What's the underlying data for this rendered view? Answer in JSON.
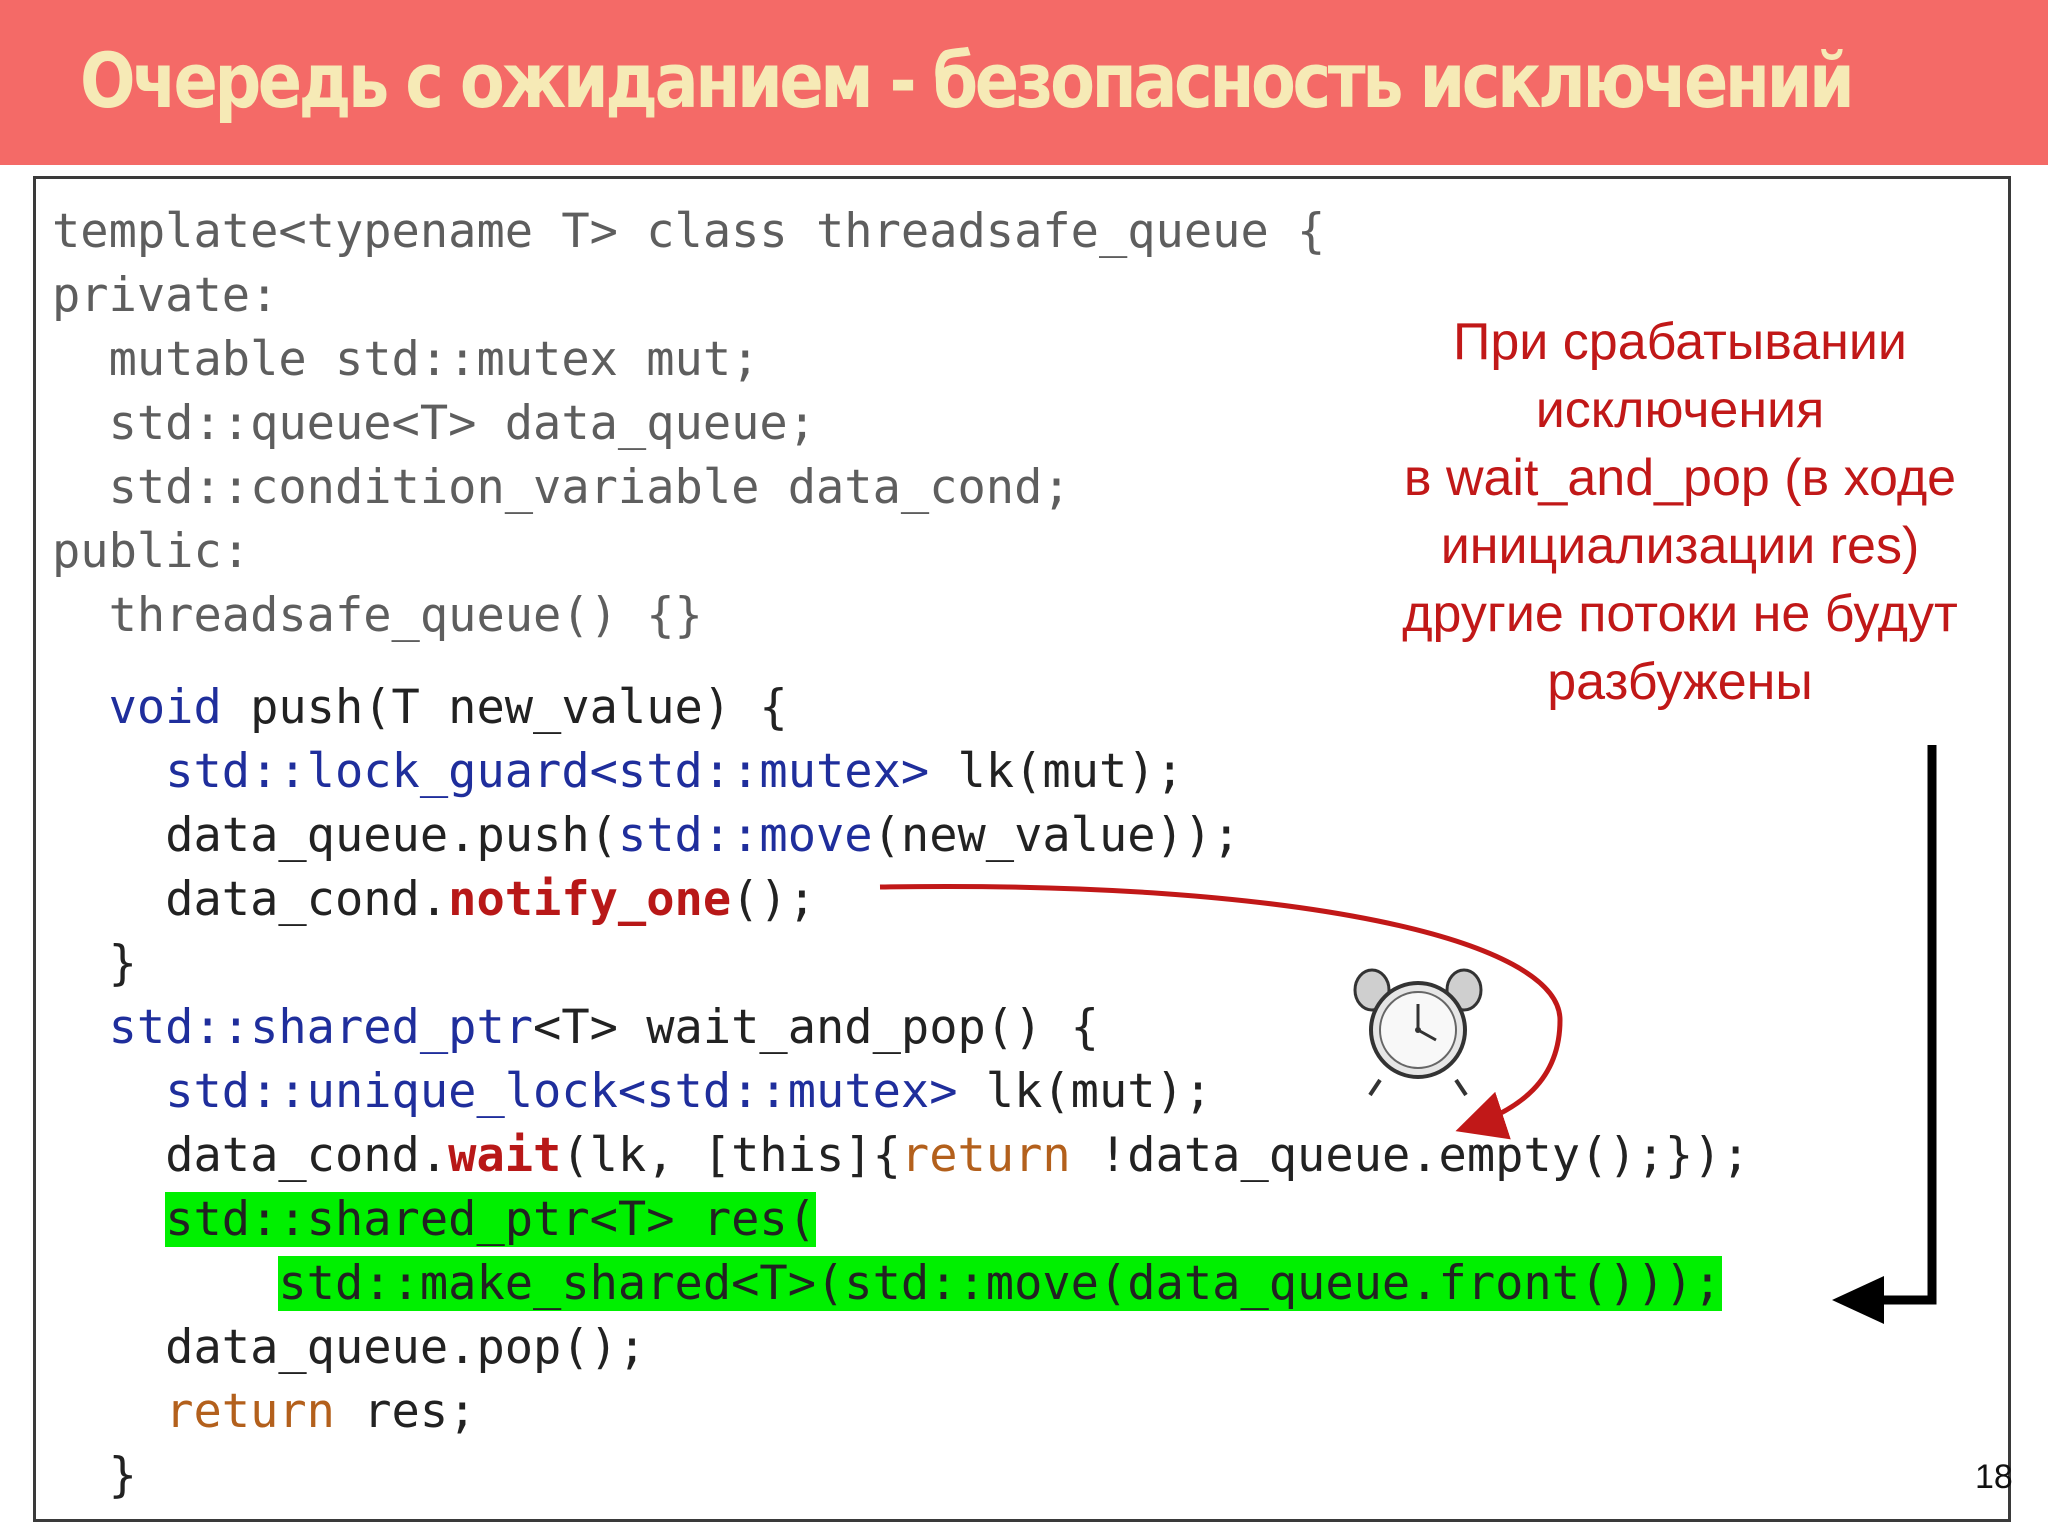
{
  "slide": {
    "title": "Очередь с ожиданием - безопасность исключений",
    "page_number": "18",
    "colors": {
      "title_bar": "#f46a67",
      "title_text": "#f6eab6",
      "keyword": "#1f2e9c",
      "return_keyword": "#b3601c",
      "notify_wait": "#b81818",
      "highlight": "#00f000",
      "note_text": "#c11818"
    }
  },
  "code": {
    "line1": "template<typename T> class threadsafe_queue {",
    "line2": "private:",
    "line3": "  mutable std::mutex mut;",
    "line4": "  std::queue<T> data_queue;",
    "line5": "  std::condition_variable data_cond;",
    "line6": "public:",
    "line7": "  threadsafe_queue() {}",
    "line8": {
      "indent": "  ",
      "kw": "void",
      "rest": " push(T new_value) {"
    },
    "line9": {
      "indent": "    ",
      "kw": "std::lock_guard<std::mutex>",
      "rest": " lk(mut);"
    },
    "line10": {
      "indent": "    ",
      "a": "data_queue.push(",
      "kw": "std::move",
      "rest": "(new_value));"
    },
    "line11": {
      "indent": "    ",
      "a": "data_cond.",
      "red": "notify_one",
      "rest": "();"
    },
    "line12": "  }",
    "line13": {
      "indent": "  ",
      "kw": "std::shared_ptr",
      "rest": "<T> wait_and_pop() {"
    },
    "line14": {
      "indent": "    ",
      "kw": "std::unique_lock<std::mutex>",
      "rest": " lk(mut);"
    },
    "line15": {
      "indent": "    ",
      "a": "data_cond.",
      "red": "wait",
      "b": "(lk, [this]{",
      "ret": "return",
      "rest": " !data_queue.empty();});"
    },
    "line16": {
      "indent": "    ",
      "hl": "std::shared_ptr<T> res("
    },
    "line17": {
      "indent": "        ",
      "hl": "std::make_shared<T>(std::move(data_queue.front()));"
    },
    "line18": "    data_queue.pop();",
    "line19": {
      "indent": "    ",
      "ret": "return",
      "rest": " res;"
    },
    "line20": "  }"
  },
  "note": {
    "line1": "При срабатывании",
    "line2": "исключения",
    "line3": "в wait_and_pop (в ходе",
    "line4": "инициализации res)",
    "line5": "другие потоки не будут",
    "line6": "разбужены"
  },
  "icons": {
    "clock": "alarm-clock-icon"
  }
}
